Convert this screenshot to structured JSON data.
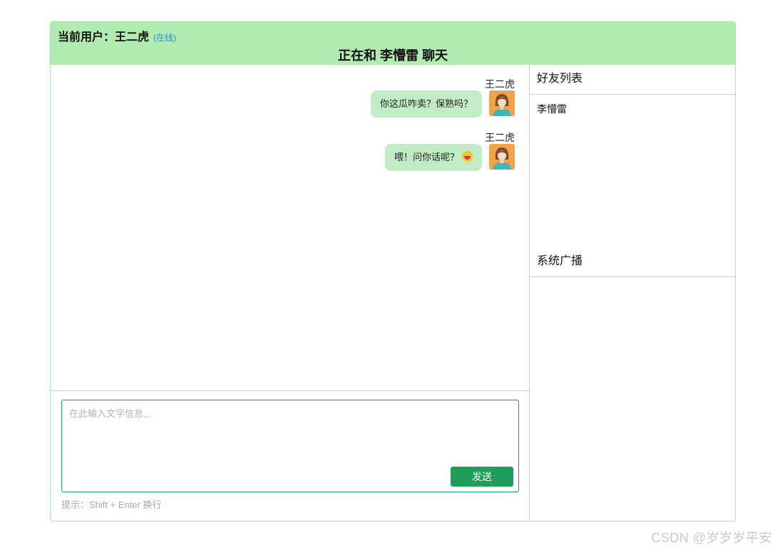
{
  "header": {
    "current_user_label": "当前用户：王二虎",
    "status": "(在线)",
    "chat_title": "正在和 李懵雷 聊天"
  },
  "messages": [
    {
      "sender": "王二虎",
      "text": "你这瓜咋卖？保熟吗？",
      "emoji": ""
    },
    {
      "sender": "王二虎",
      "text": "喂！问你话呢？",
      "emoji": "laughing-face-emoji"
    }
  ],
  "composer": {
    "placeholder": "在此输入文字信息,,,",
    "value": "",
    "send_label": "发送",
    "hint": "提示：Shift + Enter 换行"
  },
  "sidebar": {
    "friends_title": "好友列表",
    "friends": [
      "李懵雷"
    ],
    "broadcast_title": "系统广播"
  },
  "watermark": "CSDN @岁岁岁平安",
  "colors": {
    "header_bg": "#b2ebb1",
    "bubble_bg": "#c2ecc5",
    "send_button": "#1e9e5a",
    "online_status": "#1d8fd6",
    "avatar_bg": "#f1a24a"
  }
}
